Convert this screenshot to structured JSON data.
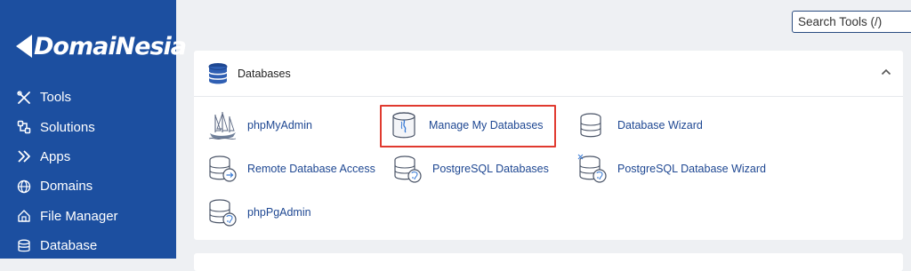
{
  "brand": {
    "name": "DomaiNesia"
  },
  "sidebar": {
    "items": [
      {
        "label": "Tools",
        "icon": "tools-icon"
      },
      {
        "label": "Solutions",
        "icon": "solutions-icon"
      },
      {
        "label": "Apps",
        "icon": "apps-icon"
      },
      {
        "label": "Domains",
        "icon": "globe-icon"
      },
      {
        "label": "File Manager",
        "icon": "file-manager-icon"
      },
      {
        "label": "Database",
        "icon": "database-icon"
      }
    ]
  },
  "search": {
    "placeholder": "Search Tools (/)"
  },
  "databases_panel": {
    "title": "Databases",
    "tools": [
      {
        "label": "phpMyAdmin",
        "icon": "phpmyadmin-icon"
      },
      {
        "label": "Manage My Databases",
        "icon": "manage-databases-icon"
      },
      {
        "label": "Database Wizard",
        "icon": "database-wizard-icon"
      },
      {
        "label": "Remote Database Access",
        "icon": "remote-database-icon"
      },
      {
        "label": "PostgreSQL Databases",
        "icon": "postgresql-databases-icon"
      },
      {
        "label": "PostgreSQL Database Wizard",
        "icon": "postgresql-wizard-icon"
      },
      {
        "label": "phpPgAdmin",
        "icon": "phppgadmin-icon"
      }
    ]
  },
  "colors": {
    "sidebar": "#1c4fa0",
    "link": "#1e4792",
    "highlight": "#e03a2f",
    "background": "#eef0f3"
  }
}
